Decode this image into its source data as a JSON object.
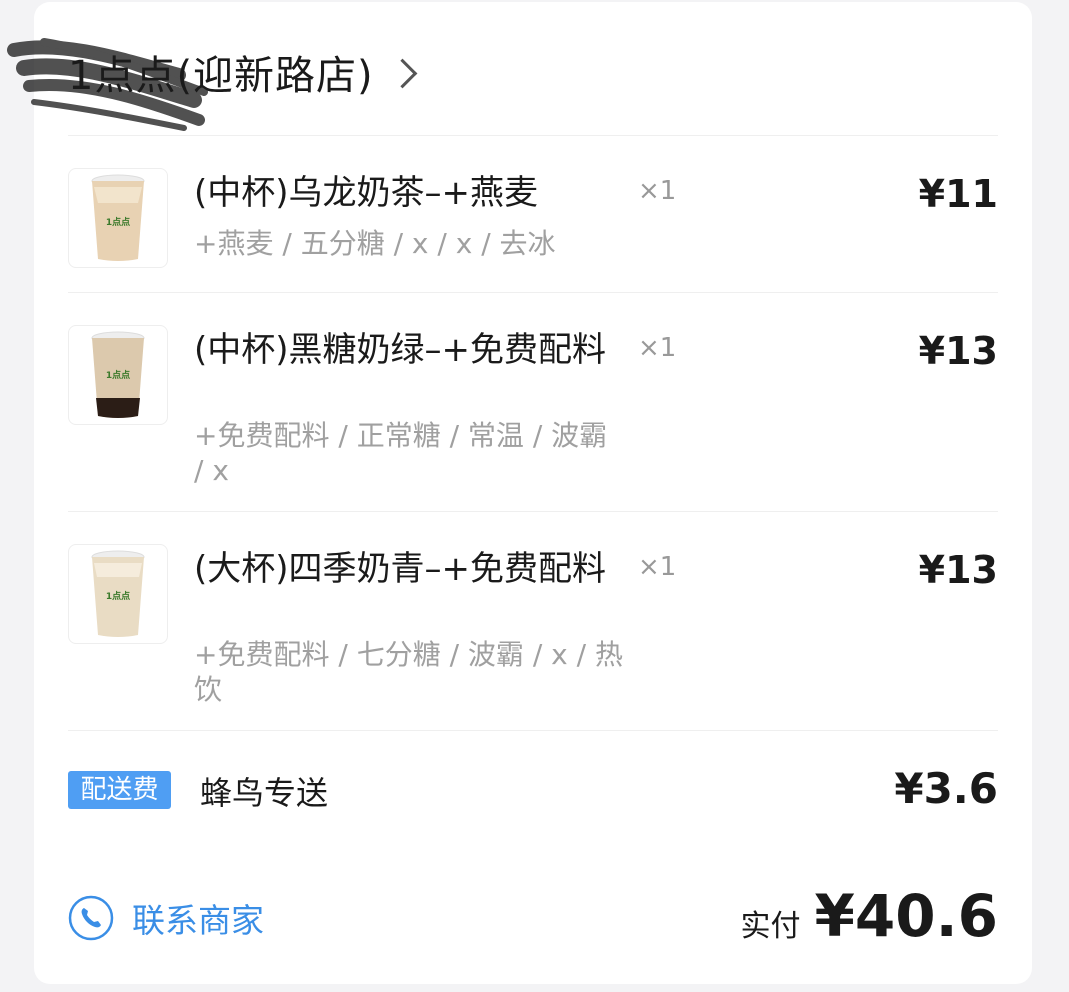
{
  "shop": {
    "name": "1点点(迎新路店)"
  },
  "items": [
    {
      "name": "(中杯)乌龙奶茶–+燕麦",
      "qty": "×1",
      "price": "¥11",
      "options": "+燕麦 / 五分糖 / x / x / 去冰"
    },
    {
      "name": "(中杯)黑糖奶绿–+免费配料",
      "qty": "×1",
      "price": "¥13",
      "options": "+免费配料 / 正常糖 / 常温 / 波霸 / x"
    },
    {
      "name": "(大杯)四季奶青–+免费配料",
      "qty": "×1",
      "price": "¥13",
      "options": "+免费配料 / 七分糖 / 波霸 / x / 热饮"
    }
  ],
  "delivery": {
    "badge": "配送费",
    "service": "蜂鸟专送",
    "price": "¥3.6"
  },
  "footer": {
    "contact_label": "联系商家",
    "total_label": "实付",
    "total_value": "¥40.6"
  },
  "colors": {
    "accent": "#4f9ef3",
    "link": "#3a8ee6",
    "muted": "#a0a0a0"
  }
}
